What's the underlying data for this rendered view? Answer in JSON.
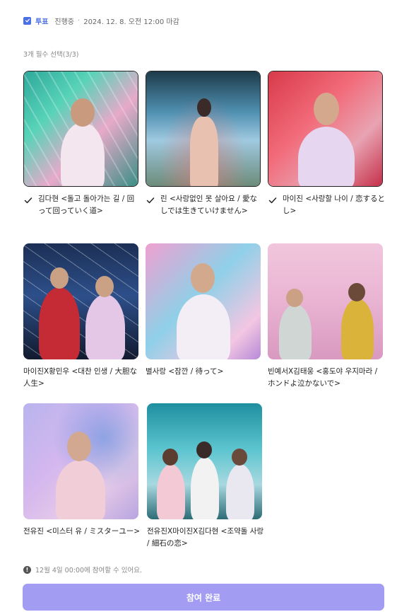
{
  "header": {
    "vote_label": "투표",
    "status": "진행중",
    "separator": "·",
    "deadline": "2024. 12. 8. 오전 12:00 마감"
  },
  "subtitle": "3개 필수 선택(3/3)",
  "options": [
    {
      "label": "김다현 <돌고 돌아가는 길 / 回って回っていく道>",
      "selected": true
    },
    {
      "label": "린 <사랑없인 못 살아요 / 愛なしでは生きていけません>",
      "selected": true
    },
    {
      "label": "마이진 <사랑할 나이 / 恋するとし>",
      "selected": true
    },
    {
      "label": "마이진X황민우 <대찬 인생 / 大胆な人生>",
      "selected": false
    },
    {
      "label": "별사랑 <잠깐 / 待って>",
      "selected": false
    },
    {
      "label": "빈예서X김태웅 <홍도야 우지마라 / ホンドよ泣かないで>",
      "selected": false
    },
    {
      "label": "전유진 <미스터 유 / ミスターユー>",
      "selected": false
    },
    {
      "label": "전유진X마이진X김다현 <조약돌 사랑 / 細石の恋>",
      "selected": false
    }
  ],
  "notice": "12월 4일 00:00에 참여할 수 있어요.",
  "submit_label": "참여 완료",
  "colors": {
    "accent": "#4b6fe6",
    "button": "#a29cf3"
  }
}
